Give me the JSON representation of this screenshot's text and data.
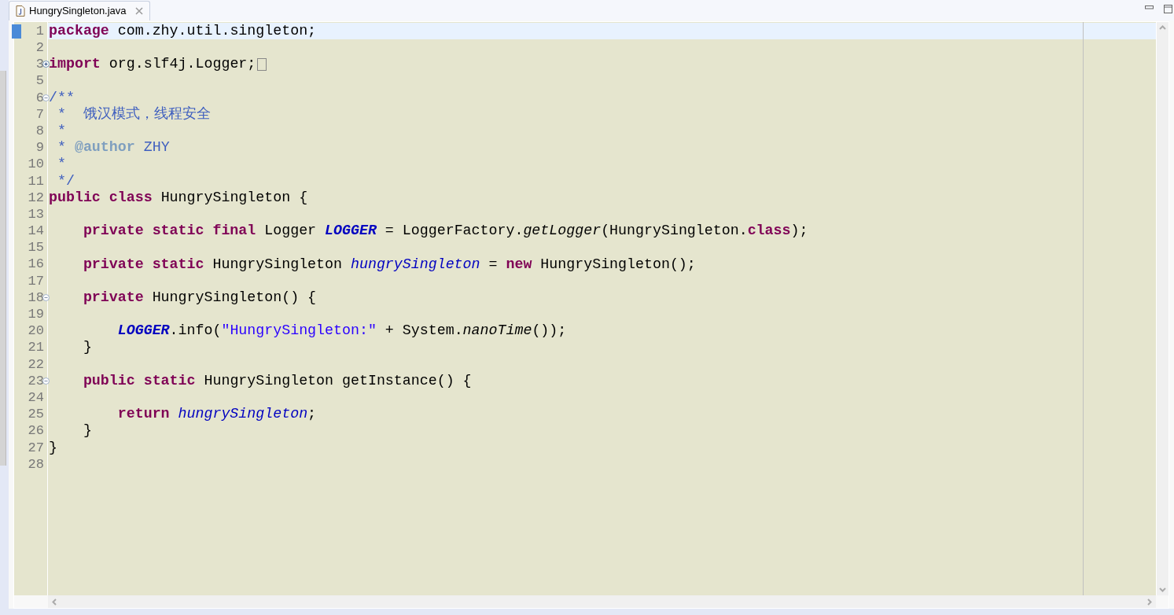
{
  "tab": {
    "title": "HungrySingleton.java",
    "selected": true
  },
  "lines": [
    {
      "number": "1",
      "current": true,
      "tokens": [
        {
          "kind": "keyword",
          "text": "package"
        },
        {
          "kind": "plain",
          "text": " com.zhy.util.singleton;"
        }
      ]
    },
    {
      "number": "2",
      "current": false
    },
    {
      "number": "3",
      "current": false,
      "folded": true,
      "tokens": [
        {
          "kind": "keyword",
          "text": "import"
        },
        {
          "kind": "plain",
          "text": " org.slf4j.Logger;"
        }
      ]
    },
    {
      "number": "5",
      "current": false
    },
    {
      "number": "6",
      "current": false,
      "folded": false,
      "tokens": [
        {
          "kind": "comment",
          "text": "/**"
        }
      ]
    },
    {
      "number": "7",
      "current": false,
      "tokens": [
        {
          "kind": "comment",
          "text": " *  饿汉模式，线程安全"
        }
      ]
    },
    {
      "number": "8",
      "current": false,
      "tokens": [
        {
          "kind": "comment",
          "text": " *"
        }
      ]
    },
    {
      "number": "9",
      "current": false,
      "tokens": [
        {
          "kind": "comment",
          "text": " * "
        },
        {
          "kind": "doctag",
          "text": "@author"
        },
        {
          "kind": "comment",
          "text": " ZHY"
        }
      ]
    },
    {
      "number": "10",
      "current": false,
      "tokens": [
        {
          "kind": "comment",
          "text": " *"
        }
      ]
    },
    {
      "number": "11",
      "current": false,
      "tokens": [
        {
          "kind": "comment",
          "text": " */"
        }
      ]
    },
    {
      "number": "12",
      "current": false,
      "tokens": [
        {
          "kind": "keyword",
          "text": "public class"
        },
        {
          "kind": "plain",
          "text": " HungrySingleton {"
        }
      ],
      "children": [
        {
          "number": "13",
          "current": false
        },
        {
          "number": "14",
          "current": false,
          "tokens": [
            {
              "kind": "keyword",
              "text": "private static final"
            },
            {
              "kind": "plain",
              "text": " Logger "
            },
            {
              "kind": "static-field",
              "text": "LOGGER"
            },
            {
              "kind": "plain",
              "text": " = LoggerFactory."
            },
            {
              "kind": "static-method",
              "text": "getLogger"
            },
            {
              "kind": "plain",
              "text": "(HungrySingleton."
            },
            {
              "kind": "keyword",
              "text": "class"
            },
            {
              "kind": "plain",
              "text": ");"
            }
          ]
        },
        {
          "number": "15",
          "current": false
        },
        {
          "number": "16",
          "current": false,
          "tokens": [
            {
              "kind": "keyword",
              "text": "private static"
            },
            {
              "kind": "plain",
              "text": " HungrySingleton "
            },
            {
              "kind": "field",
              "text": "hungrySingleton"
            },
            {
              "kind": "plain",
              "text": " = "
            },
            {
              "kind": "keyword",
              "text": "new"
            },
            {
              "kind": "plain",
              "text": " HungrySingleton();"
            }
          ]
        },
        {
          "number": "17",
          "current": false
        },
        {
          "number": "18",
          "current": false,
          "folded": false,
          "tokens": [
            {
              "kind": "keyword",
              "text": "private"
            },
            {
              "kind": "plain",
              "text": " HungrySingleton() {"
            }
          ],
          "children": [
            {
              "number": "19",
              "current": false
            },
            {
              "number": "20",
              "current": false,
              "tokens": [
                {
                  "kind": "static-field",
                  "text": "LOGGER"
                },
                {
                  "kind": "plain",
                  "text": ".info("
                },
                {
                  "kind": "string",
                  "text": "\"HungrySingleton:\""
                },
                {
                  "kind": "plain",
                  "text": " + System."
                },
                {
                  "kind": "static-method",
                  "text": "nanoTime"
                },
                {
                  "kind": "plain",
                  "text": "());"
                }
              ]
            }
          ]
        },
        {
          "number": "21",
          "current": false,
          "tokens": [
            {
              "kind": "plain",
              "text": "}"
            }
          ]
        },
        {
          "number": "22",
          "current": false
        },
        {
          "number": "23",
          "current": false,
          "folded": false,
          "tokens": [
            {
              "kind": "keyword",
              "text": "public static"
            },
            {
              "kind": "plain",
              "text": " HungrySingleton getInstance() {"
            }
          ],
          "children": [
            {
              "number": "24",
              "current": false
            },
            {
              "number": "25",
              "current": false,
              "tokens": [
                {
                  "kind": "keyword",
                  "text": "return"
                },
                {
                  "kind": "field",
                  "text": " hungrySingleton"
                },
                {
                  "kind": "plain",
                  "text": ";"
                }
              ]
            }
          ]
        },
        {
          "number": "26",
          "current": false,
          "tokens": [
            {
              "kind": "plain",
              "text": "}"
            }
          ]
        }
      ]
    },
    {
      "number": "27",
      "current": false,
      "tokens": [
        {
          "kind": "plain",
          "text": "}"
        }
      ]
    },
    {
      "number": "28",
      "current": false
    }
  ]
}
